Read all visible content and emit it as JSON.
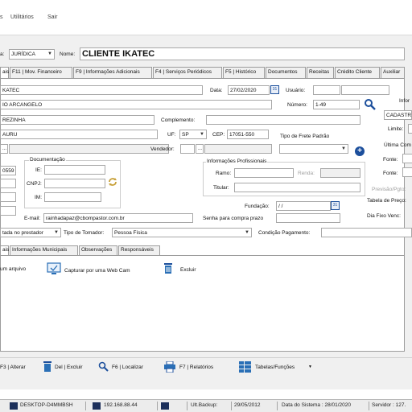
{
  "menu": {
    "item1": "s",
    "utilitarios": "Utilitários",
    "sair": "Sair"
  },
  "header": {
    "tipo_label": "a:",
    "tipo_value": "JURÍDICA",
    "nome_label": "Nome:",
    "nome_value": "CLIENTE IKATEC"
  },
  "tabs": [
    "ais",
    "F11 | Mov. Financeiro",
    "F9 | Informações Adicionais",
    "F4 | Serviços Periódicos",
    "F5 | Histórico",
    "Documentos",
    "Receitas",
    "Crédito Cliente",
    "Auxiliar"
  ],
  "form": {
    "field1": "KATEC",
    "data_label": "Data:",
    "data_value": "27/02/2020",
    "usuario_label": "Usuário:",
    "info_label": "Infor",
    "field2": "IO ARCANGELO",
    "numero_label": "Número:",
    "numero_value": "1-49",
    "cadastro": "CADASTR",
    "field3": "REZINHA",
    "complemento_label": "Complemento:",
    "limite_label": "Limite:",
    "field4": "AURU",
    "uf_label": "UF:",
    "uf_value": "SP",
    "cep_label": "CEP:",
    "cep_value": "17051-550",
    "tipo_frete_label": "Tipo de Frete Padrão",
    "ultima_label": "Última Com",
    "vendedor_label": "Vendedor:",
    "fonte1_label": "Fonte:",
    "fonte2_label": "Fonte:",
    "documentacao_label": "Documentação",
    "ie_label": "IE:",
    "cnpj_label": "CNPJ:",
    "im_label": "IM:",
    "partial_num": "0559",
    "info_prof_label": "Informações Profissionais",
    "ramo_label": "Ramo:",
    "renda_label": "Renda:",
    "titular_label": "Titular:",
    "previsao_label": "Previsão/Pgto:",
    "tabela_preco_label": "Tabela de Preço:",
    "fundacao_label": "Fundação:",
    "fundacao_value": " / /",
    "dia_fixo_label": "Dia Fixo Venc:",
    "email_label": "E-mail:",
    "email_value": "rainhadapaz@cbompastor.com.br",
    "senha_label": "Senha para compra prazo",
    "prestador_value": "tada no prestador",
    "tipo_tomador_label": "Tipo de Tomador:",
    "tipo_tomador_value": "Pessoa Física",
    "condicao_label": "Condição Pagamento:"
  },
  "subtabs": [
    "ais",
    "Informações Municipais",
    "Observações",
    "Responsáveis"
  ],
  "actions": {
    "arquivo": "um arquivo",
    "webcam": "Capturar por uma Web Cam",
    "excluir": "Excluir"
  },
  "footer": {
    "alterar": "F3 | Alterar",
    "excluir": "Del | Excluir",
    "localizar": "F6 | Localizar",
    "relatorios": "F7 | Relatórios",
    "tabelas": "Tabelas/Funções"
  },
  "status": {
    "host": "DESKTOP-D4MMBSH",
    "ip": "192.168.88.44",
    "ult_backup": "Ult.Backup:",
    "backup_date": "29/05/2012",
    "data_sistema": "Data do Sistema : 28/01/2020",
    "servidor": "Servidor : 127."
  },
  "colors": {
    "accent": "#1c4f9c",
    "panel_bg": "#f0f0f0",
    "field_border": "#a8a8a8"
  }
}
